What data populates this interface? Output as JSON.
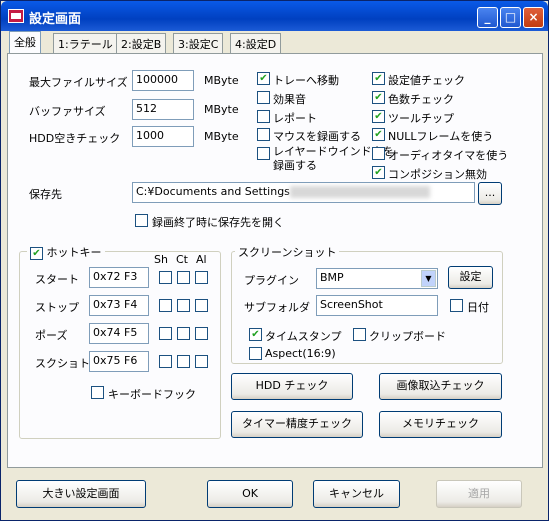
{
  "window": {
    "title": "設定画面",
    "minimize": "_",
    "maximize": "□",
    "close": "×"
  },
  "tabs": [
    "全般",
    "1:ラテール",
    "2:設定B",
    "3:設定C",
    "4:設定D"
  ],
  "general": {
    "max_file_size_label": "最大ファイルサイズ",
    "max_file_size_value": "100000",
    "max_file_size_unit": "MByte",
    "buffer_size_label": "バッファサイズ",
    "buffer_size_value": "512",
    "buffer_size_unit": "MByte",
    "hdd_check_label": "HDD空きチェック",
    "hdd_check_value": "1000",
    "hdd_check_unit": "MByte",
    "save_to_label": "保存先",
    "save_to_value": "C:¥Documents and Settings",
    "browse_label": "...",
    "open_folder_label": "録画終了時に保存先を開く"
  },
  "options_left": [
    {
      "label": "トレーへ移動",
      "checked": true
    },
    {
      "label": "効果音",
      "checked": false
    },
    {
      "label": "レポート",
      "checked": false
    },
    {
      "label": "マウスを録画する",
      "checked": false
    },
    {
      "label": "レイヤードウインドウを\n録画する",
      "checked": false
    }
  ],
  "options_right": [
    {
      "label": "設定値チェック",
      "checked": true
    },
    {
      "label": "色数チェック",
      "checked": true
    },
    {
      "label": "ツールチップ",
      "checked": true
    },
    {
      "label": "NULLフレームを使う",
      "checked": true
    },
    {
      "label": "オーディオタイマを使う",
      "checked": false
    },
    {
      "label": "コンポジション無効",
      "checked": true
    }
  ],
  "hotkey": {
    "title": "ホットキー",
    "cols": [
      "Sh",
      "Ct",
      "Al"
    ],
    "rows": [
      {
        "label": "スタート",
        "value": "0x72 F3"
      },
      {
        "label": "ストップ",
        "value": "0x73 F4"
      },
      {
        "label": "ポーズ",
        "value": "0x74 F5"
      },
      {
        "label": "スクショト",
        "value": "0x75 F6"
      }
    ],
    "keyboard_hook": "キーボードフック"
  },
  "screenshot": {
    "title": "スクリーンショット",
    "plugin_label": "プラグイン",
    "plugin_value": "BMP",
    "settings_button": "設定",
    "subfolder_label": "サブフォルダ",
    "subfolder_value": "ScreenShot",
    "date_label": "日付",
    "timestamp_label": "タイムスタンプ",
    "clipboard_label": "クリップボード",
    "aspect_label": "Aspect(16:9)"
  },
  "tools": {
    "hdd_check": "HDD チェック",
    "image_capture_check": "画像取込チェック",
    "timer_precision_check": "タイマー精度チェック",
    "memory_check": "メモリチェック"
  },
  "footer": {
    "large_settings": "大きい設定画面",
    "ok": "OK",
    "cancel": "キャンセル",
    "apply": "適用"
  }
}
